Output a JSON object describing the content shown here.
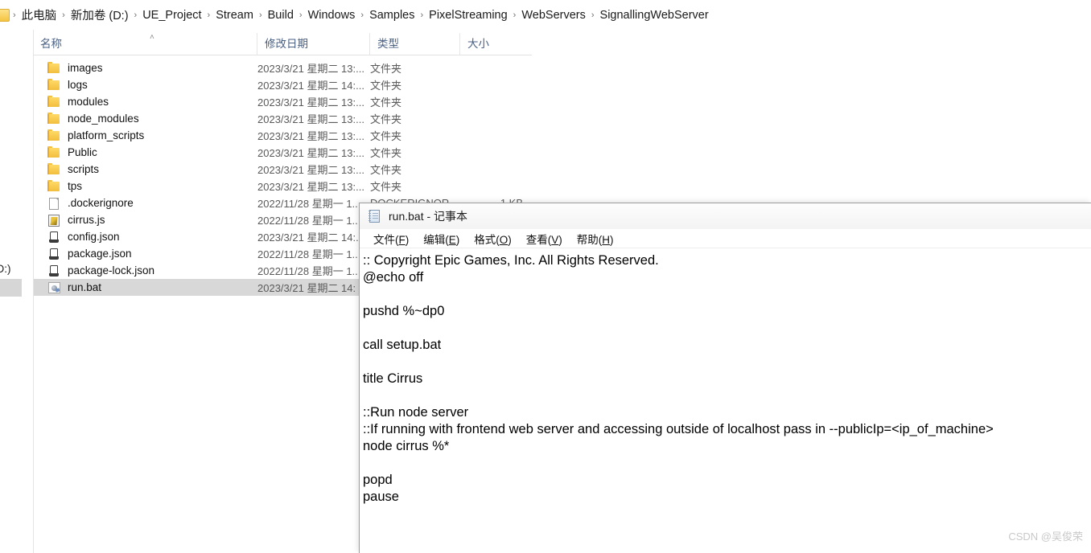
{
  "explorer": {
    "breadcrumb": {
      "icon": "folder-icon",
      "items": [
        "此电脑",
        "新加卷 (D:)",
        "UE_Project",
        "Stream",
        "Build",
        "Windows",
        "Samples",
        "PixelStreaming",
        "WebServers",
        "SignallingWebServer"
      ],
      "separator": "›"
    },
    "nav_partial": {
      "label": "(D:)"
    },
    "columns": [
      {
        "label": "名称",
        "sorted": true,
        "sort_caret": "˄"
      },
      {
        "label": "修改日期"
      },
      {
        "label": "类型"
      },
      {
        "label": "大小"
      }
    ],
    "rows": [
      {
        "icon": "folder-icon",
        "name": "images",
        "date": "2023/3/21 星期二 13:...",
        "type": "文件夹",
        "size": ""
      },
      {
        "icon": "folder-icon",
        "name": "logs",
        "date": "2023/3/21 星期二 14:...",
        "type": "文件夹",
        "size": ""
      },
      {
        "icon": "folder-icon",
        "name": "modules",
        "date": "2023/3/21 星期二 13:...",
        "type": "文件夹",
        "size": ""
      },
      {
        "icon": "folder-icon",
        "name": "node_modules",
        "date": "2023/3/21 星期二 13:...",
        "type": "文件夹",
        "size": ""
      },
      {
        "icon": "folder-icon",
        "name": "platform_scripts",
        "date": "2023/3/21 星期二 13:...",
        "type": "文件夹",
        "size": ""
      },
      {
        "icon": "folder-icon",
        "name": "Public",
        "date": "2023/3/21 星期二 13:...",
        "type": "文件夹",
        "size": ""
      },
      {
        "icon": "folder-icon",
        "name": "scripts",
        "date": "2023/3/21 星期二 13:...",
        "type": "文件夹",
        "size": ""
      },
      {
        "icon": "folder-icon",
        "name": "tps",
        "date": "2023/3/21 星期二 13:...",
        "type": "文件夹",
        "size": ""
      },
      {
        "icon": "document-icon",
        "name": ".dockerignore",
        "date": "2022/11/28 星期一 1..",
        "type": "DOCKERIGNOR",
        "size": "1 KB"
      },
      {
        "icon": "js-script-icon",
        "name": "cirrus.js",
        "date": "2022/11/28 星期一 1..",
        "type": "",
        "size": ""
      },
      {
        "icon": "json-file-icon",
        "name": "config.json",
        "date": "2023/3/21 星期二 14:.",
        "type": "",
        "size": ""
      },
      {
        "icon": "json-file-icon",
        "name": "package.json",
        "date": "2022/11/28 星期一 1..",
        "type": "",
        "size": ""
      },
      {
        "icon": "json-file-icon",
        "name": "package-lock.json",
        "date": "2022/11/28 星期一 1..",
        "type": "",
        "size": ""
      },
      {
        "icon": "bat-file-icon",
        "name": "run.bat",
        "date": "2023/3/21 星期二 14:",
        "type": "",
        "size": "",
        "selected": true
      }
    ]
  },
  "notepad": {
    "icon": "notepad-icon",
    "title": "run.bat - 记事本",
    "menu": [
      {
        "label": "文件(F)",
        "accel": "F"
      },
      {
        "label": "编辑(E)",
        "accel": "E"
      },
      {
        "label": "格式(O)",
        "accel": "O"
      },
      {
        "label": "查看(V)",
        "accel": "V"
      },
      {
        "label": "帮助(H)",
        "accel": "H"
      }
    ],
    "content_lines": [
      ":: Copyright Epic Games, Inc. All Rights Reserved.",
      "@echo off",
      "",
      "pushd %~dp0",
      "",
      "call setup.bat",
      "",
      "title Cirrus",
      "",
      "::Run node server",
      "::If running with frontend web server and accessing outside of localhost pass in --publicIp=<ip_of_machine>",
      "node cirrus %*",
      "",
      "popd",
      "pause"
    ]
  },
  "watermark": "CSDN @吴俊荣",
  "colors": {
    "selection": "#d8d8d8",
    "column_header_text": "#4a6083",
    "folder_yellow": "#f2bf3e"
  }
}
